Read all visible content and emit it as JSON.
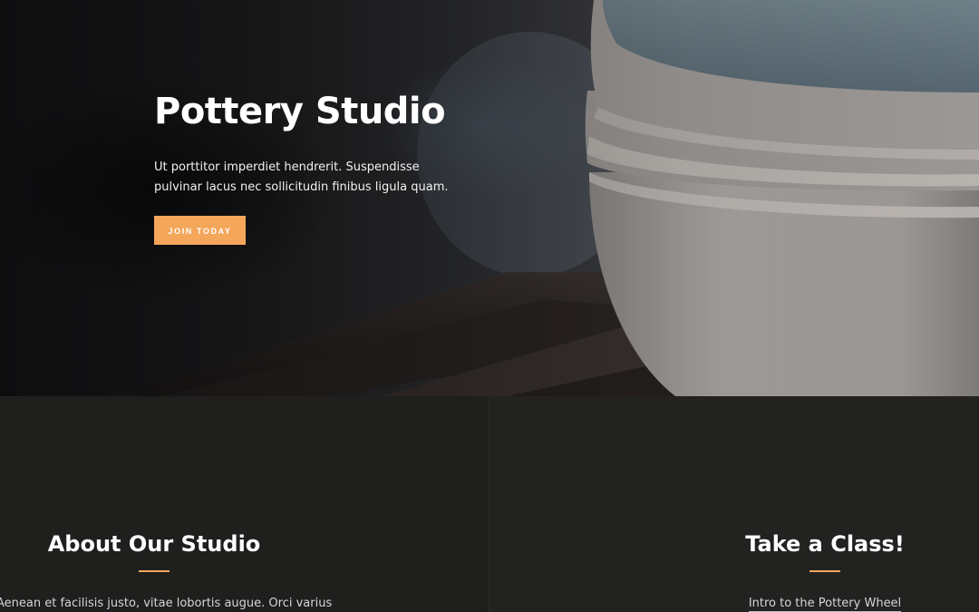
{
  "hero": {
    "title": "Pottery Studio",
    "text": "Ut porttitor imperdiet hendrerit. Suspendisse pulvinar lacus nec sollicitudin finibus ligula quam.",
    "button_label": "JOIN TODAY",
    "background_image": "stacked-ceramic-bowls-photo"
  },
  "about": {
    "heading": "About Our Studio",
    "text": "Aenean et facilisis justo, vitae lobortis augue. Orci varius"
  },
  "classes": {
    "heading": "Take a Class!",
    "link_text": "Intro to the Pottery Wheel"
  },
  "colors": {
    "accent": "#f4a65a",
    "section_background": "#1f1f1e",
    "heading_text": "#ffffff"
  }
}
